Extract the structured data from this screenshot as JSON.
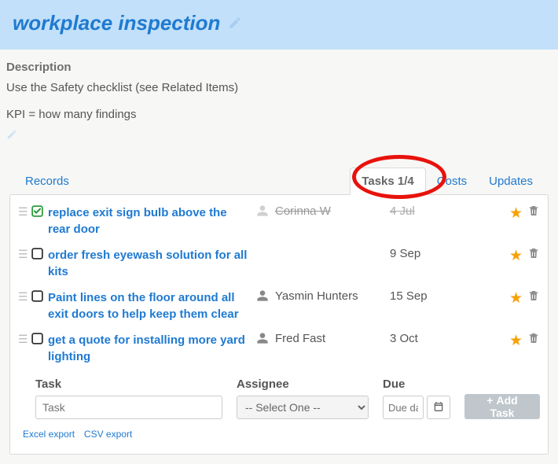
{
  "header": {
    "title": "workplace inspection"
  },
  "description": {
    "label": "Description",
    "line1": "Use the Safety checklist (see Related Items)",
    "line2": "KPI = how many findings"
  },
  "tabs": {
    "records": "Records",
    "tasks": "Tasks 1/4",
    "costs": "Costs",
    "updates": "Updates"
  },
  "tasks": [
    {
      "title": "replace exit sign bulb above the rear door",
      "assignee": "Corinna W",
      "due": "4 Jul",
      "done": true
    },
    {
      "title": "order fresh eyewash solution for all kits",
      "assignee": "",
      "due": "9 Sep",
      "done": false
    },
    {
      "title": "Paint lines on the floor around all exit doors to help keep them clear",
      "assignee": "Yasmin Hunters",
      "due": "15 Sep",
      "done": false
    },
    {
      "title": "get a quote for installing more yard lighting",
      "assignee": "Fred Fast",
      "due": "3 Oct",
      "done": false
    }
  ],
  "form": {
    "task_label": "Task",
    "task_placeholder": "Task",
    "assignee_label": "Assignee",
    "assignee_placeholder": "-- Select One --",
    "due_label": "Due",
    "due_placeholder": "Due date",
    "add_button": "Add Task"
  },
  "exports": {
    "excel": "Excel export",
    "csv": "CSV export"
  }
}
